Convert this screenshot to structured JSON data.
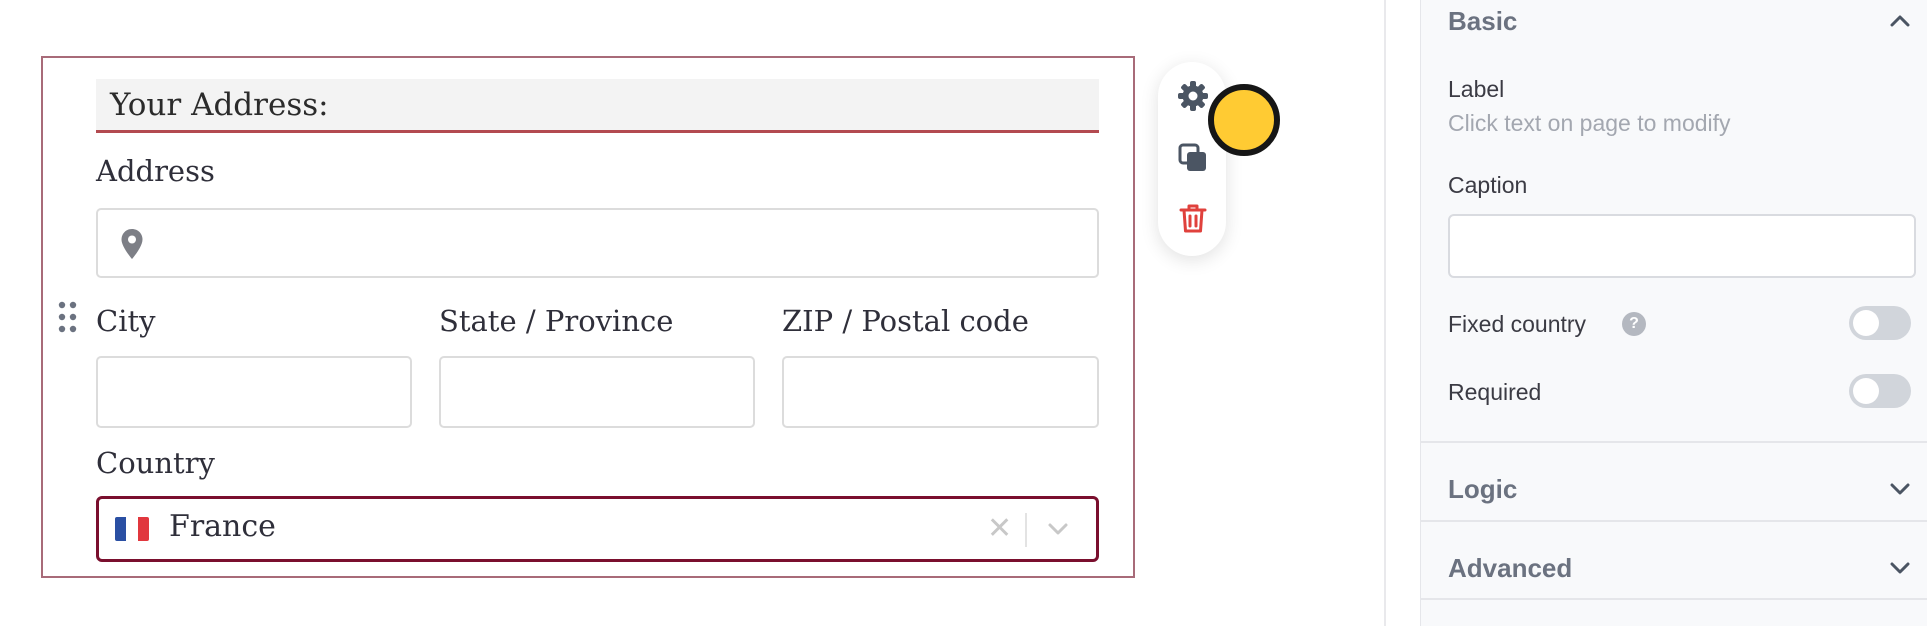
{
  "form": {
    "section_title": "Your Address:",
    "address": {
      "label": "Address",
      "value": "",
      "icon": "map-pin-icon"
    },
    "city": {
      "label": "City",
      "value": ""
    },
    "state": {
      "label": "State / Province",
      "value": ""
    },
    "zip": {
      "label": "ZIP / Postal code",
      "value": ""
    },
    "country": {
      "label": "Country",
      "value": "France",
      "flag": "🇫🇷",
      "clear": "✕"
    }
  },
  "toolbar": {
    "settings_icon": "gear-icon",
    "duplicate_icon": "copy-icon",
    "delete_icon": "trash-icon"
  },
  "panel": {
    "basic": {
      "title": "Basic",
      "expanded": true
    },
    "label": {
      "title": "Label",
      "hint": "Click text on page to modify"
    },
    "caption": {
      "title": "Caption",
      "value": ""
    },
    "fixed_country": {
      "label": "Fixed country",
      "help": "?",
      "on": false
    },
    "required": {
      "label": "Required",
      "on": false
    },
    "logic": {
      "title": "Logic",
      "expanded": false
    },
    "advanced": {
      "title": "Advanced",
      "expanded": false
    }
  },
  "colors": {
    "block_border": "#a86b79",
    "title_underline": "#b34a50",
    "country_border": "#7a0f2e",
    "delete_red": "#e0413c",
    "cursor": "#ffcb33"
  }
}
